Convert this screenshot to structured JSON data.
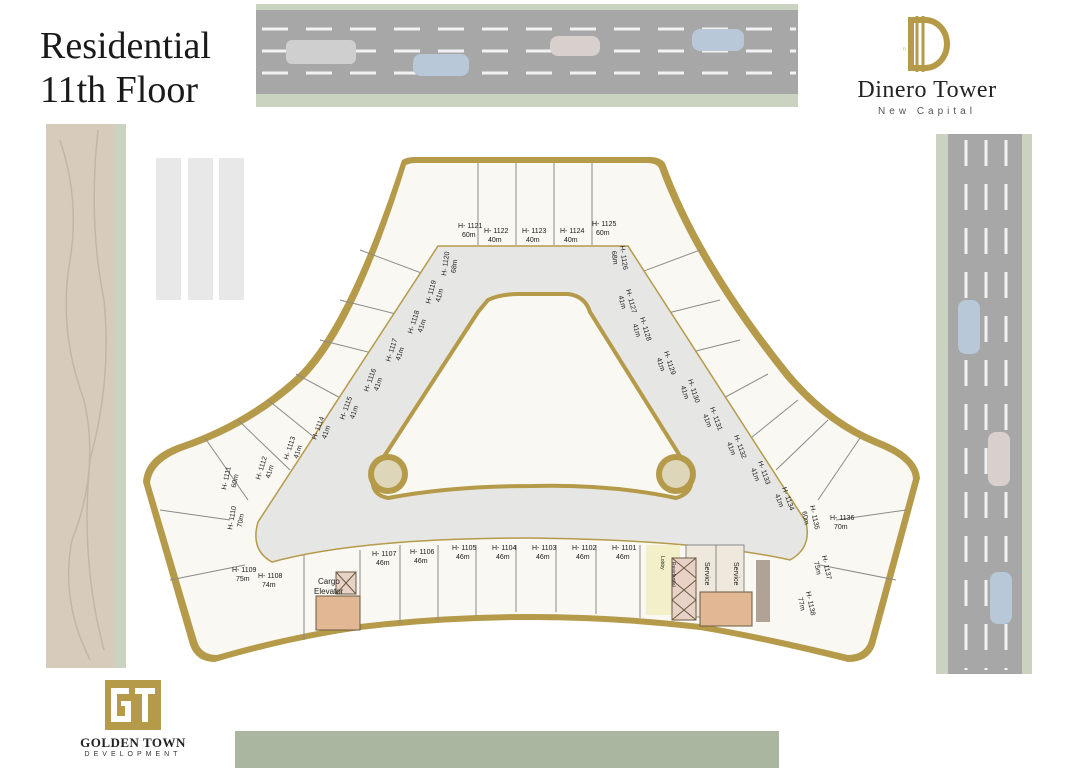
{
  "title": {
    "line1": "Residential",
    "line2": "11th Floor"
  },
  "brand": {
    "name": "Dinero Tower",
    "subtitle": "New Capital",
    "monogram": "D",
    "icon": "dinero-logo-icon"
  },
  "developer": {
    "name": "GOLDEN TOWN",
    "subtitle": "DEVELOPMENT",
    "monogram": "GT",
    "icon": "golden-town-logo-icon"
  },
  "colors": {
    "accent_gold": "#b59a4a",
    "corridor": "#e6e6e4",
    "road": "#a7a7a7",
    "verge": "#c9d3bf",
    "walkway": "#d7ccbc"
  },
  "units": [
    {
      "id": "H- 1101",
      "area": "46m"
    },
    {
      "id": "H- 1102",
      "area": "46m"
    },
    {
      "id": "H- 1103",
      "area": "46m"
    },
    {
      "id": "H- 1104",
      "area": "46m"
    },
    {
      "id": "H- 1105",
      "area": "46m"
    },
    {
      "id": "H- 1106",
      "area": "46m"
    },
    {
      "id": "H- 1107",
      "area": "46m"
    },
    {
      "id": "H- 1108",
      "area": "74m"
    },
    {
      "id": "H- 1109",
      "area": "75m"
    },
    {
      "id": "H- 1110",
      "area": "70m"
    },
    {
      "id": "H- 1111",
      "area": "60m"
    },
    {
      "id": "H- 1112",
      "area": "41m"
    },
    {
      "id": "H- 1113",
      "area": "41m"
    },
    {
      "id": "H- 1114",
      "area": "41m"
    },
    {
      "id": "H- 1115",
      "area": "41m"
    },
    {
      "id": "H- 1116",
      "area": "41m"
    },
    {
      "id": "H- 1117",
      "area": "41m"
    },
    {
      "id": "H- 1118",
      "area": "41m"
    },
    {
      "id": "H- 1119",
      "area": "41m"
    },
    {
      "id": "H- 1120",
      "area": "68m"
    },
    {
      "id": "H- 1121",
      "area": "60m"
    },
    {
      "id": "H- 1122",
      "area": "40m"
    },
    {
      "id": "H- 1123",
      "area": "40m"
    },
    {
      "id": "H- 1124",
      "area": "40m"
    },
    {
      "id": "H- 1125",
      "area": "60m"
    },
    {
      "id": "H- 1126",
      "area": "68m"
    },
    {
      "id": "H- 1127",
      "area": "41m"
    },
    {
      "id": "H- 1128",
      "area": "41m"
    },
    {
      "id": "H- 1129",
      "area": "41m"
    },
    {
      "id": "H- 1130",
      "area": "41m"
    },
    {
      "id": "H- 1131",
      "area": "41m"
    },
    {
      "id": "H- 1132",
      "area": "41m"
    },
    {
      "id": "H- 1133",
      "area": "41m"
    },
    {
      "id": "H- 1134",
      "area": "41m"
    },
    {
      "id": "H- 1135",
      "area": "60m"
    },
    {
      "id": "H- 1136",
      "area": "70m"
    },
    {
      "id": "H- 1137",
      "area": "75m"
    },
    {
      "id": "H- 1138",
      "area": "77m"
    }
  ],
  "service_labels": {
    "cargo": "Cargo",
    "elevator": "Elevator",
    "service1": "Service",
    "service2": "Service",
    "lobby": "Lobby",
    "residential": "Residential"
  }
}
